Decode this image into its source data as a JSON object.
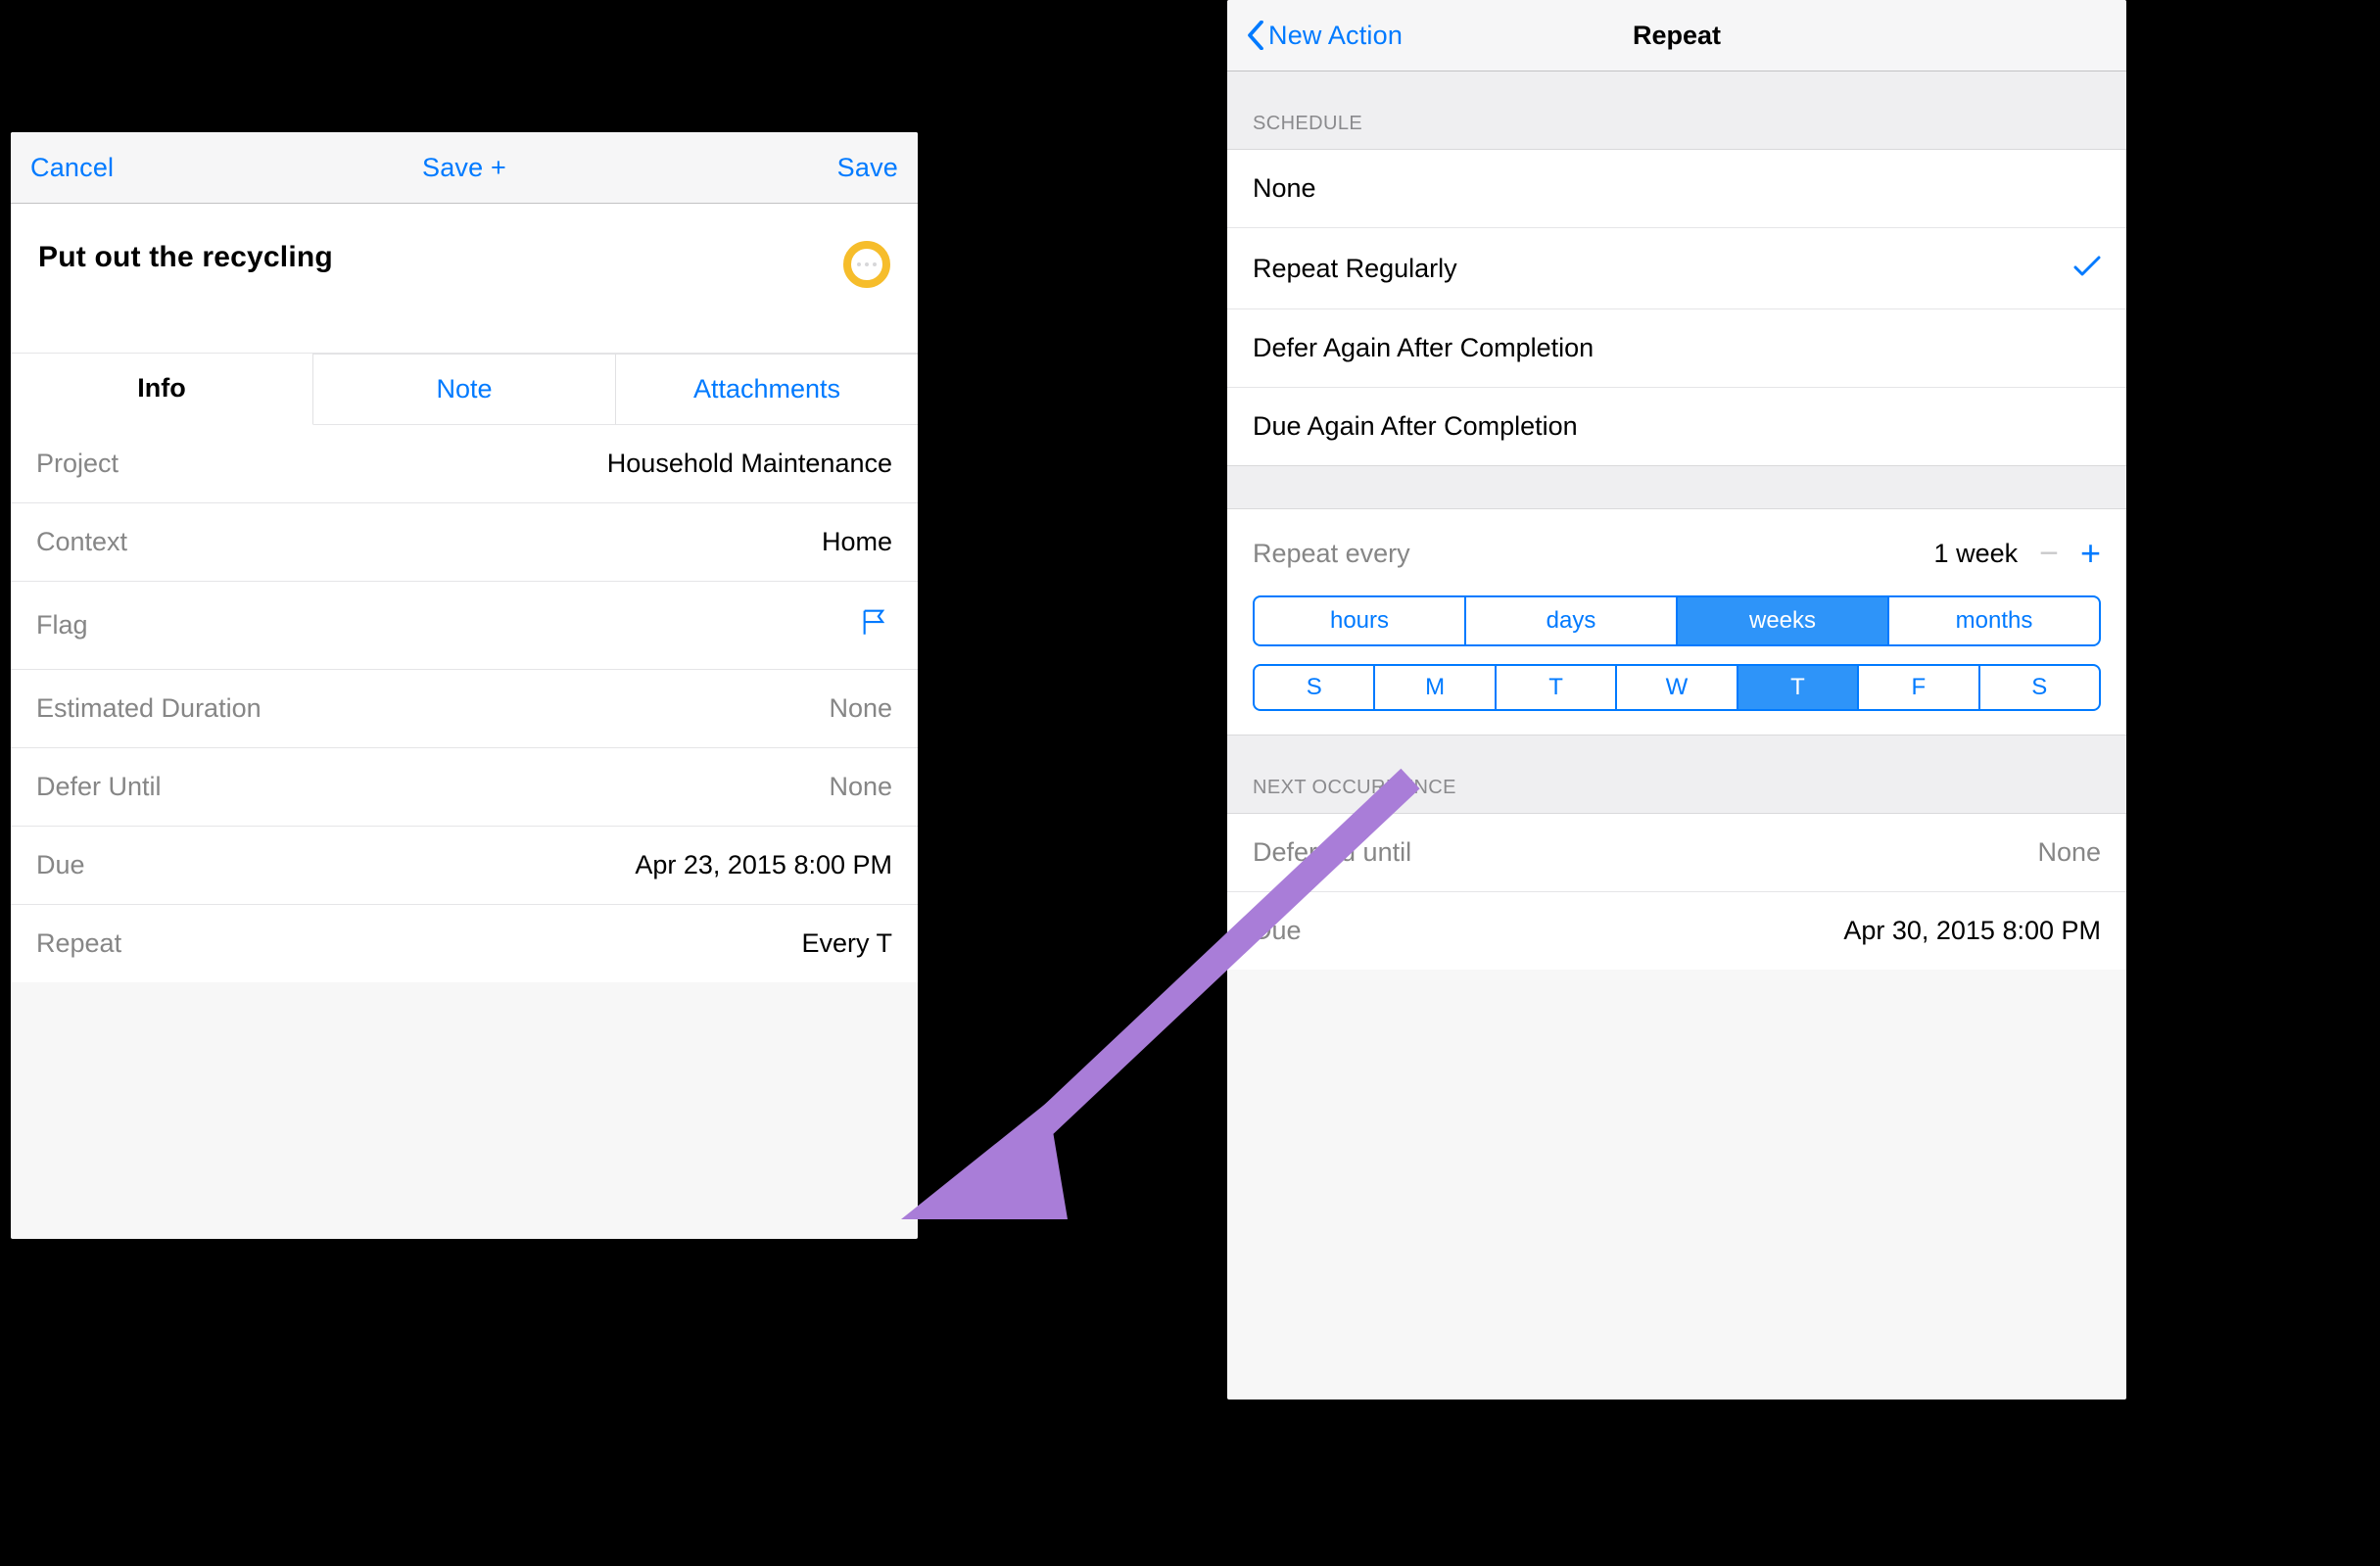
{
  "colors": {
    "accent": "#007aff",
    "status_ring": "#f6bd2b",
    "arrow": "#a97dd8"
  },
  "left": {
    "nav": {
      "cancel": "Cancel",
      "save_plus": "Save +",
      "save": "Save"
    },
    "task_title": "Put out the recycling",
    "tabs": {
      "info": "Info",
      "note": "Note",
      "attachments": "Attachments",
      "active": "info"
    },
    "rows": {
      "project": {
        "label": "Project",
        "value": "Household Maintenance"
      },
      "context": {
        "label": "Context",
        "value": "Home"
      },
      "flag": {
        "label": "Flag",
        "value": ""
      },
      "duration": {
        "label": "Estimated Duration",
        "value": "None"
      },
      "defer": {
        "label": "Defer Until",
        "value": "None"
      },
      "due": {
        "label": "Due",
        "value": "Apr 23, 2015  8:00 PM"
      },
      "repeat": {
        "label": "Repeat",
        "value": "Every T"
      }
    }
  },
  "right": {
    "nav": {
      "back": "New Action",
      "title": "Repeat"
    },
    "schedule_header": "Schedule",
    "schedule": {
      "none": "None",
      "regular": "Repeat Regularly",
      "defer_after": "Defer Again After Completion",
      "due_after": "Due Again After Completion",
      "selected": "regular"
    },
    "repeat_every": {
      "label": "Repeat every",
      "value": "1 week"
    },
    "units": {
      "options": [
        "hours",
        "days",
        "weeks",
        "months"
      ],
      "selected": "weeks"
    },
    "days": {
      "options": [
        "S",
        "M",
        "T",
        "W",
        "T",
        "F",
        "S"
      ],
      "selected_index": 4
    },
    "next_header": "Next Occurrence",
    "next": {
      "deferred": {
        "label": "Deferred until",
        "value": "None"
      },
      "due": {
        "label": "Due",
        "value": "Apr 30, 2015  8:00 PM"
      }
    }
  }
}
